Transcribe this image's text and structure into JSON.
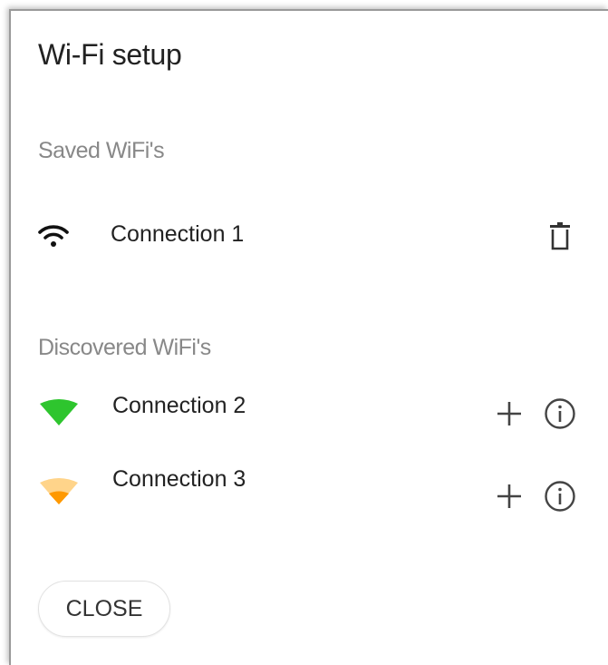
{
  "dialog": {
    "title": "Wi-Fi setup",
    "close_label": "CLOSE"
  },
  "saved": {
    "label": "Saved WiFi's",
    "items": [
      {
        "name": "Connection 1",
        "icon": "wifi-signal-icon",
        "action_icon": "trash-icon"
      }
    ]
  },
  "discovered": {
    "label": "Discovered WiFi's",
    "items": [
      {
        "name": "Connection 2",
        "icon": "wifi-strength-full-icon",
        "color": "#2ec52e",
        "actions": [
          "add-icon",
          "info-icon"
        ]
      },
      {
        "name": "Connection 3",
        "icon": "wifi-strength-weak-icon",
        "color": "#ff9900",
        "faded_color": "#ffd48a",
        "actions": [
          "add-icon",
          "info-icon"
        ]
      }
    ]
  }
}
